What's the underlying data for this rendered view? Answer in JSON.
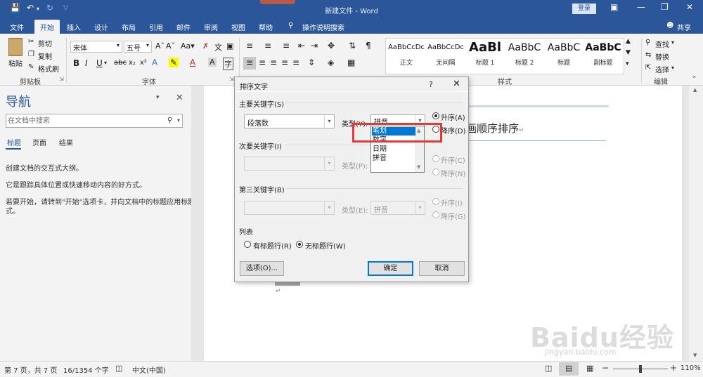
{
  "app": {
    "doc_title": "新建文件 - Word",
    "login": "登录"
  },
  "tabs": [
    "文件",
    "开始",
    "插入",
    "设计",
    "布局",
    "引用",
    "邮件",
    "审阅",
    "视图",
    "帮助",
    "操作说明搜索"
  ],
  "share": "共享",
  "ribbon": {
    "clipboard": {
      "paste": "粘贴",
      "cut": "剪切",
      "copy": "复制",
      "painter": "格式刷",
      "label": "剪贴板"
    },
    "font": {
      "name": "宋体",
      "size": "五号",
      "label": "字体"
    },
    "styles": {
      "items": [
        {
          "preview": "AaBbCcDc",
          "name": "正文"
        },
        {
          "preview": "AaBbCcDc",
          "name": "无间隔"
        },
        {
          "preview": "AaBl",
          "name": "标题 1"
        },
        {
          "preview": "AaBbC",
          "name": "标题 2"
        },
        {
          "preview": "AaBbC",
          "name": "标题"
        },
        {
          "preview": "AaBbC",
          "name": "副标题"
        }
      ],
      "label": "样式"
    },
    "editing": {
      "find": "查找",
      "replace": "替换",
      "select": "选择",
      "label": "编辑"
    }
  },
  "nav": {
    "title": "导航",
    "search_placeholder": "在文档中搜索",
    "tabs": [
      "标题",
      "页面",
      "结果"
    ],
    "text1": "创建文档的交互式大纲。",
    "text2": "它是跟踪具体位置或快速移动内容的好方式。",
    "text3": "若要开始，请转到\"开始\"选项卡，并向文档中的标题应用标题样式。"
  },
  "document": {
    "visible_text": "笔画顺序排序",
    "return_mark": "↵"
  },
  "dialog": {
    "title": "排序文字",
    "help": "?",
    "primary_label": "主要关键字(S)",
    "primary_value": "段落数",
    "type_label": "类型(Y):",
    "type_value": "拼音",
    "asc": "升序(A)",
    "desc": "降序(D)",
    "list_options": [
      "笔划",
      "数字",
      "日期",
      "拼音"
    ],
    "selected_option": "笔划",
    "secondary_label": "次要关键字(I)",
    "secondary_type_label": "类型(P):",
    "asc2": "升序(C)",
    "desc2": "降序(N)",
    "third_label": "第三关键字(B)",
    "third_type_label": "类型(E):",
    "third_type_value": "拼音",
    "asc3": "升序(I)",
    "desc3": "降序(G)",
    "list_section": "列表",
    "has_header": "有标题行(R)",
    "no_header": "无标题行(W)",
    "options_btn": "选项(O)...",
    "ok_btn": "确定",
    "cancel_btn": "取消"
  },
  "status": {
    "page": "第 7 页，共 7 页",
    "words": "16/1354 个字",
    "lang": "中文(中国)",
    "zoom": "110%"
  },
  "watermark": {
    "brand": "Baidu经验",
    "url": "jingyan.baidu.com"
  },
  "colors": {
    "brand_blue": "#2b579a",
    "selection": "#0078d7",
    "highlight_box": "#e53935"
  }
}
